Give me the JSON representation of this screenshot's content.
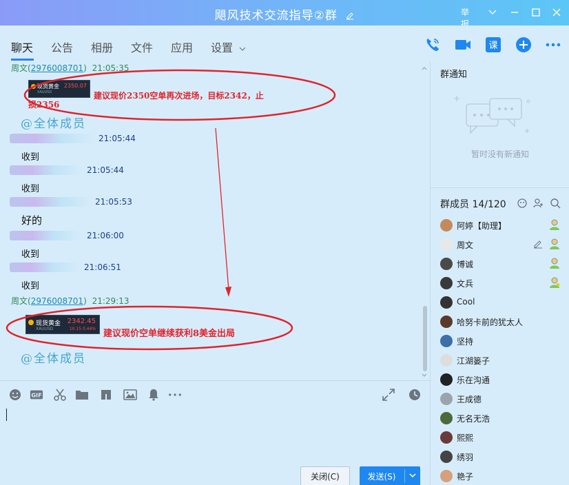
{
  "window": {
    "title": "飓风技术交流指导②群",
    "report_label": "举报"
  },
  "tabs": [
    "聊天",
    "公告",
    "相册",
    "文件",
    "应用",
    "设置"
  ],
  "chat": {
    "msg1": {
      "sender": "周文",
      "qq": "2976008701",
      "time": "21:05:35",
      "quote": {
        "name": "现货黄金",
        "price": "2350.07",
        "sub": "XAUUSD"
      },
      "text_line1": "建议现价2350空单再次进场，目标2342，止",
      "text_line2": "损2356",
      "at_all": "@全体成员"
    },
    "replies": [
      {
        "time": "21:05:44",
        "text": "收到"
      },
      {
        "time": "21:05:44",
        "text": "收到"
      },
      {
        "time": "21:05:53",
        "text": "好的"
      },
      {
        "time": "21:06:00",
        "text": "收到"
      },
      {
        "time": "21:06:51",
        "text": "收到"
      }
    ],
    "msg2": {
      "sender": "周文",
      "qq": "2976008701",
      "time": "21:29:13",
      "quote": {
        "name": "现货黄金",
        "price": "2342.45",
        "sub": "XAUUSD",
        "change": "10.15",
        "pct": "0.44%"
      },
      "text": "建议现价空单继续获利8美金出局",
      "at_all": "@全体成员"
    }
  },
  "input": {
    "close_label": "关闭(C)",
    "send_label": "发送(S)"
  },
  "right": {
    "notice_title": "群通知",
    "notice_empty": "暂时没有新通知",
    "members_title": "群成员 14/120",
    "members": [
      {
        "name": "阿婷【助理】",
        "role": "admin"
      },
      {
        "name": "周文",
        "role": "admin"
      },
      {
        "name": "博诚",
        "role": "admin"
      },
      {
        "name": "文兵",
        "role": "owner"
      },
      {
        "name": "Cool",
        "role": ""
      },
      {
        "name": "哈努卡前的犹太人",
        "role": ""
      },
      {
        "name": "坚持",
        "role": ""
      },
      {
        "name": "江湖篓子",
        "role": ""
      },
      {
        "name": "乐在沟通",
        "role": ""
      },
      {
        "name": "王成德",
        "role": ""
      },
      {
        "name": "无名无浩",
        "role": ""
      },
      {
        "name": "熙熙",
        "role": ""
      },
      {
        "name": "绣羽",
        "role": ""
      },
      {
        "name": "艳子",
        "role": ""
      }
    ]
  },
  "colors": {
    "accent": "#1e88f0",
    "annotation_red": "#e0242c",
    "background": "#d7ecfb"
  }
}
